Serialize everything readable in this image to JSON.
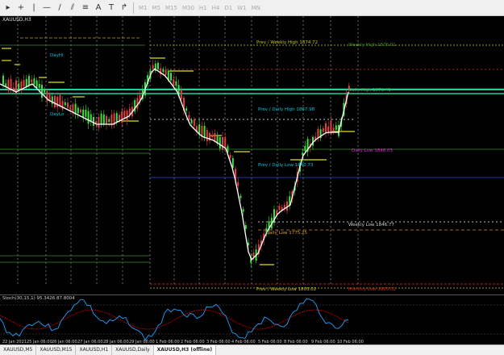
{
  "toolbar": {
    "timeframes": [
      "M1",
      "M5",
      "M15",
      "M30",
      "H1",
      "H4",
      "D1",
      "W1",
      "MN"
    ]
  },
  "chart": {
    "title": "XAUUSD,H3",
    "price_labels": [
      {
        "text": "Prev / Weekly High 1874.72",
        "color": "#c8c820"
      },
      {
        "text": "Weekly High 1876.01",
        "color": "#3a8a2a"
      },
      {
        "text": "Daily High 1871.41",
        "color": "#5a9a40"
      },
      {
        "text": "Prev / Daily High 1867.98",
        "color": "#00c8e0"
      },
      {
        "text": "Daily Low 1848.03",
        "color": "#e020e0"
      },
      {
        "text": "Prev / Daily Low 1840.73",
        "color": "#00c8e0"
      },
      {
        "text": "Weekly Low 1846.77",
        "color": "#d0d0d0"
      },
      {
        "text": "Daily Low 1775.25",
        "color": "#e0a020"
      },
      {
        "text": "Prev / Weekly Low 1805.02",
        "color": "#c8c820"
      },
      {
        "text": "Monthly Low 1805.02",
        "color": "#e02020"
      }
    ],
    "side_labels": [
      {
        "text": "DayHi",
        "color": "#00c8e0"
      },
      {
        "text": "DayLo",
        "color": "#00c8e0"
      }
    ],
    "date_labels": [
      "22 Jan 2021",
      "25 Jan 06:00",
      "26 Jan 06:00",
      "27 Jan 06:00",
      "28 Jan 06:00",
      "29 Jan 06:00",
      "1 Feb 06:00",
      "2 Feb 06:00",
      "3 Feb 06:00",
      "4 Feb 06:00",
      "5 Feb 06:00",
      "8 Feb 06:00",
      "9 Feb 06:00",
      "10 Feb 06:00"
    ]
  },
  "oscillator": {
    "title": "Stoch(30,15,1) 95.3426 87.8004"
  },
  "tabs": [
    "XAUUSD,M5",
    "XAUUSD,M15",
    "XAUUSD,H1",
    "XAUUSD,Daily",
    "XAUUSD,H3 (offline)"
  ],
  "colors": {
    "bull_candle": "#40e040",
    "bear_candle": "#e04040",
    "ma_line": "#ffffff",
    "stoch_main": "#20a0ff",
    "stoch_signal": "#c00000"
  }
}
